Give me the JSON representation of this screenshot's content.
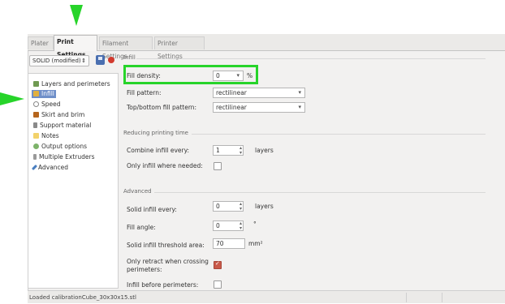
{
  "tabs": [
    {
      "label": "Plater"
    },
    {
      "label": "Print Settings"
    },
    {
      "label": "Filament Settings"
    },
    {
      "label": "Printer Settings"
    }
  ],
  "preset": {
    "value": "SOLID (modified)"
  },
  "sidebar": {
    "items": [
      {
        "label": "Layers and perimeters"
      },
      {
        "label": "Infill"
      },
      {
        "label": "Speed"
      },
      {
        "label": "Skirt and brim"
      },
      {
        "label": "Support material"
      },
      {
        "label": "Notes"
      },
      {
        "label": "Output options"
      },
      {
        "label": "Multiple Extruders"
      },
      {
        "label": "Advanced"
      }
    ]
  },
  "infill": {
    "title": "Infill",
    "fill_density_label": "Fill density:",
    "fill_density_value": "0",
    "fill_density_unit": "%",
    "fill_pattern_label": "Fill pattern:",
    "fill_pattern_value": "rectilinear",
    "top_bottom_label": "Top/bottom fill pattern:",
    "top_bottom_value": "rectilinear"
  },
  "reducing": {
    "title": "Reducing printing time",
    "combine_label": "Combine infill every:",
    "combine_value": "1",
    "combine_unit": "layers",
    "only_where_needed_label": "Only infill where needed:"
  },
  "advanced": {
    "title": "Advanced",
    "solid_every_label": "Solid infill every:",
    "solid_every_value": "0",
    "solid_every_unit": "layers",
    "fill_angle_label": "Fill angle:",
    "fill_angle_value": "0",
    "fill_angle_unit": "°",
    "threshold_label": "Solid infill threshold area:",
    "threshold_value": "70",
    "threshold_unit": "mm²",
    "only_retract_label_1": "Only retract when crossing",
    "only_retract_label_2": "perimeters:",
    "infill_before_label": "Infill before perimeters:"
  },
  "status": {
    "text": "Loaded calibrationCube_30x30x15.stl"
  },
  "colors": {
    "annotation": "#27d42a",
    "selection": "#6f8fc9"
  }
}
